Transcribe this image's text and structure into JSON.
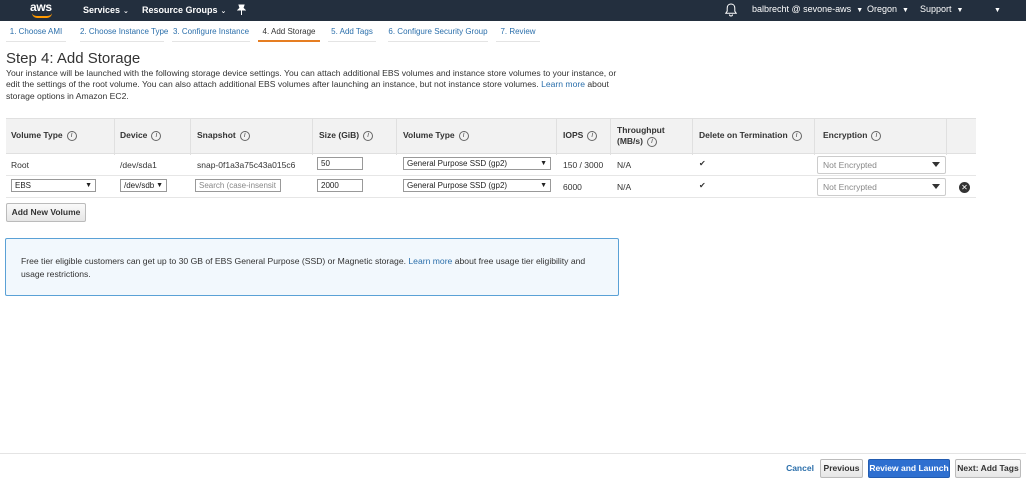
{
  "nav": {
    "logo": "aws",
    "services": "Services",
    "resource_groups": "Resource Groups",
    "user": "balbrecht @ sevone-aws",
    "region": "Oregon",
    "support": "Support",
    "caret": "⌄"
  },
  "tabs": [
    {
      "label": "1. Choose AMI"
    },
    {
      "label": "2. Choose Instance Type"
    },
    {
      "label": "3. Configure Instance"
    },
    {
      "label": "4. Add Storage"
    },
    {
      "label": "5. Add Tags"
    },
    {
      "label": "6. Configure Security Group"
    },
    {
      "label": "7. Review"
    }
  ],
  "page": {
    "title": "Step 4: Add Storage",
    "description": "Your instance will be launched with the following storage device settings. You can attach additional EBS volumes and instance store volumes to your instance, or edit the settings of the root volume. You can also attach additional EBS volumes after launching an instance, but not instance store volumes.",
    "learn_more": "Learn more",
    "description_tail": "about storage options in Amazon EC2."
  },
  "table": {
    "headers": {
      "volume_type": "Volume Type",
      "device": "Device",
      "snapshot": "Snapshot",
      "size": "Size (GiB)",
      "volume_type2": "Volume Type",
      "iops": "IOPS",
      "throughput_1": "Throughput",
      "throughput_2": "(MB/s)",
      "delete": "Delete on Termination",
      "encryption": "Encryption",
      "info": "i"
    },
    "rows": [
      {
        "volume_type": "Root",
        "device": "/dev/sda1",
        "snapshot": "snap-0f1a3a75c43a015c6",
        "size": "50",
        "volume_kind": "General Purpose SSD (gp2)",
        "iops": "150 / 3000",
        "throughput": "N/A",
        "delete_checked": "✔",
        "encryption": "Not Encrypted"
      },
      {
        "volume_type": "EBS",
        "device": "/dev/sdb",
        "snapshot_placeholder": "Search (case-insensit",
        "size": "2000",
        "volume_kind": "General Purpose SSD (gp2)",
        "iops": "6000",
        "throughput": "N/A",
        "delete_checked": "✔",
        "encryption": "Not Encrypted",
        "remove": "✕"
      }
    ],
    "select_arrow": "▼"
  },
  "add_volume_label": "Add New Volume",
  "note": {
    "text": "Free tier eligible customers can get up to 30 GB of EBS General Purpose (SSD) or Magnetic storage.",
    "learn_more": "Learn more",
    "tail": "about free usage tier eligibility and usage restrictions."
  },
  "footer": {
    "cancel": "Cancel",
    "previous": "Previous",
    "review_launch": "Review and Launch",
    "next": "Next: Add Tags"
  },
  "colors": {
    "nav_bg": "#232f3e",
    "accent": "#ff9900",
    "link": "#2b6fab",
    "primary_button": "#2e6fd0"
  }
}
